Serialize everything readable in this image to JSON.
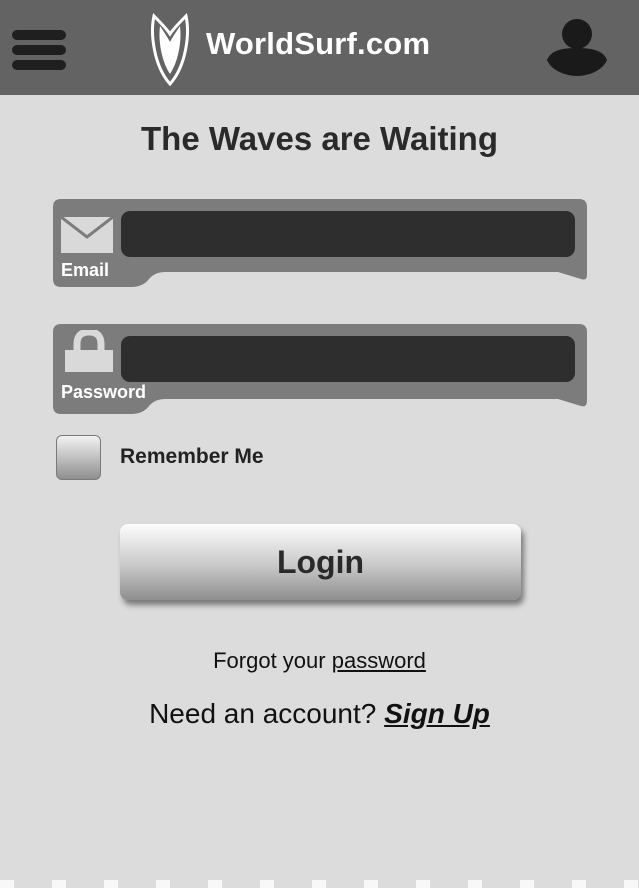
{
  "header": {
    "brand": "WorldSurf.com",
    "menu_icon": "hamburger-menu-icon",
    "logo_icon": "surfboard-logo-icon",
    "user_icon": "user-profile-icon",
    "bar_color": "#636363"
  },
  "page": {
    "heading": "The Waves are Waiting"
  },
  "form": {
    "email": {
      "label": "Email",
      "value": "",
      "placeholder": "",
      "icon": "envelope-icon"
    },
    "password": {
      "label": "Password",
      "value": "",
      "placeholder": "",
      "icon": "lock-icon"
    },
    "remember_label": "Remember Me",
    "remember_checked": false,
    "login_label": "Login"
  },
  "links": {
    "forgot_prefix": "Forgot your ",
    "forgot_link": "password",
    "signup_prefix": "Need an account? ",
    "signup_link": "Sign Up"
  }
}
